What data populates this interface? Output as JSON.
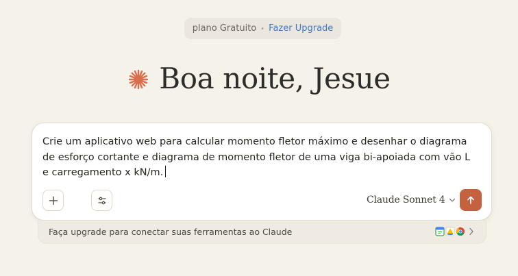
{
  "plan": {
    "label": "plano Gratuito",
    "separator": "•",
    "upgrade_label": "Fazer Upgrade"
  },
  "greeting": {
    "text": "Boa noite, Jesue",
    "icon": "spark-icon"
  },
  "composer": {
    "prompt_lines": [
      "Crie um aplicativo web para calcular momento fletor máximo e desenhar o diagrama",
      "de esforço cortante e diagrama de momento fletor de uma viga bi-apoiada com vão L",
      "e carregamento x kN/m."
    ],
    "model": "Claude Sonnet 4",
    "buttons": {
      "add": "plus-icon",
      "tools": "sliders-icon",
      "send": "arrow-up-icon"
    }
  },
  "banner": {
    "text": "Faça upgrade para conectar suas ferramentas ao Claude",
    "icons": [
      "google-calendar-icon",
      "google-drive-icon",
      "google-chrome-icon"
    ],
    "chevron": "chevron-right-icon"
  },
  "colors": {
    "background": "#f5f2ea",
    "accent": "#c4613f",
    "link": "#3d79c6",
    "spark": "#d96e4d",
    "card": "#ffffff"
  }
}
